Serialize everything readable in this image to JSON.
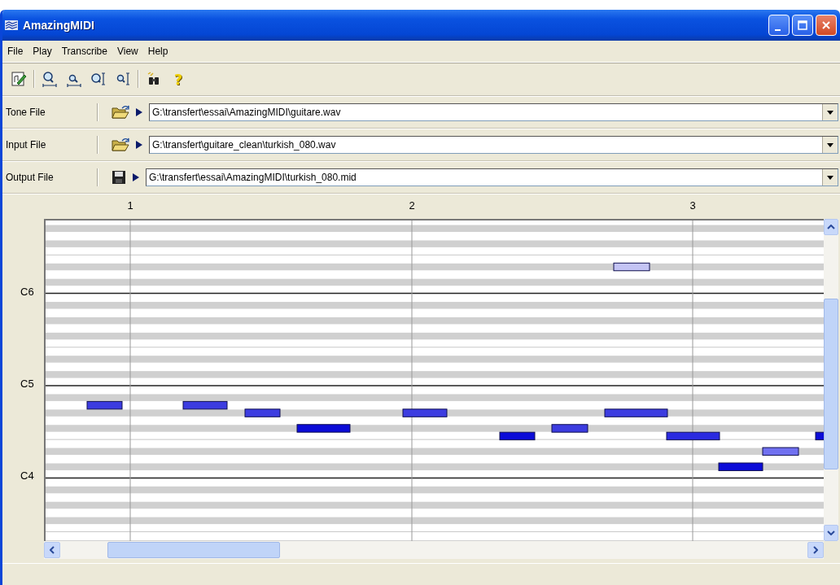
{
  "window": {
    "title": "AmazingMIDI"
  },
  "menu": [
    "File",
    "Play",
    "Transcribe",
    "View",
    "Help"
  ],
  "toolbar": [
    {
      "kind": "edit"
    },
    {
      "kind": "sep"
    },
    {
      "kind": "zoom-in-h"
    },
    {
      "kind": "zoom-out-h"
    },
    {
      "kind": "zoom-in-v"
    },
    {
      "kind": "zoom-out-v"
    },
    {
      "kind": "sep"
    },
    {
      "kind": "find"
    },
    {
      "kind": "help",
      "glyph": "?"
    }
  ],
  "files": [
    {
      "label": "Tone File",
      "kind": "open",
      "path": "G:\\transfert\\essai\\AmazingMIDI\\guitare.wav"
    },
    {
      "label": "Input File",
      "kind": "open",
      "path": "G:\\transfert\\guitare_clean\\turkish_080.wav"
    },
    {
      "label": "Output File",
      "kind": "save",
      "path": "G:\\transfert\\essai\\AmazingMIDI\\turkish_080.mid"
    }
  ],
  "ruler": [
    "1",
    "2",
    "3"
  ],
  "octaves": [
    "C6",
    "C5",
    "C4"
  ]
}
